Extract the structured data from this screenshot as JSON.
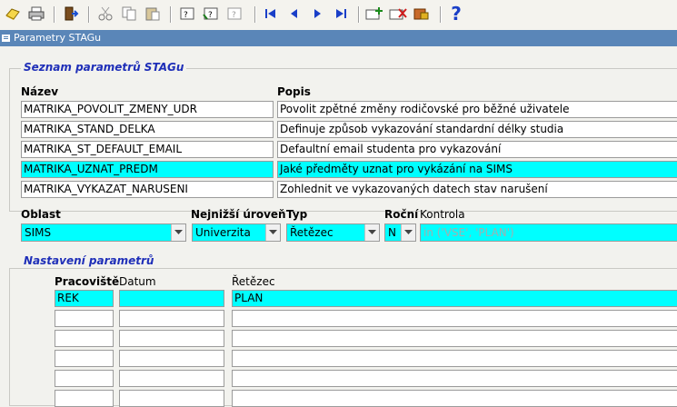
{
  "window": {
    "title": "Parametry STAGu"
  },
  "toolbar": {
    "icons": [
      "save-icon",
      "print-icon",
      "exit-icon",
      "cut-icon",
      "copy-icon",
      "paste-icon",
      "query-icon",
      "execute-query-icon",
      "cancel-query-icon",
      "first-record-icon",
      "previous-record-icon",
      "next-record-icon",
      "last-record-icon",
      "insert-record-icon",
      "delete-record-icon",
      "lock-record-icon",
      "help-icon"
    ],
    "help_label": "?"
  },
  "param_list": {
    "section_title": "Seznam parametrů STAGu",
    "col_name_header": "Název",
    "col_desc_header": "Popis",
    "rows": [
      {
        "name": "MATRIKA_POVOLIT_ZMENY_UDR",
        "desc": "Povolit zpětné změny rodičovské pro běžné uživatele",
        "selected": false
      },
      {
        "name": "MATRIKA_STAND_DELKA",
        "desc": "Definuje způsob vykazování standardní délky studia",
        "selected": false
      },
      {
        "name": "MATRIKA_ST_DEFAULT_EMAIL",
        "desc": "Defaultní email studenta pro vykazování",
        "selected": false
      },
      {
        "name": "MATRIKA_UZNAT_PREDM",
        "desc": "Jaké předměty uznat pro vykázání na SIMS",
        "selected": true
      },
      {
        "name": "MATRIKA_VYKAZAT_NARUSENI",
        "desc": "Zohlednit ve vykazovaných datech stav narušení",
        "selected": false
      }
    ]
  },
  "detail": {
    "oblast_label": "Oblast",
    "oblast_value": "SIMS",
    "uroven_label": "Nejnižší úroveň",
    "uroven_value": "Univerzita",
    "typ_label": "Typ",
    "typ_value": "Řetězec",
    "rocni_label": "Roční",
    "rocni_value": "N",
    "kontrola_label": "Kontrola",
    "kontrola_value": "in ('VSE', 'PLAN')"
  },
  "settings": {
    "section_title": "Nastavení parametrů",
    "col_pracoviste": "Pracoviště",
    "col_datum": "Datum",
    "col_retezec": "Řetězec",
    "rows": [
      {
        "pracoviste": "REK",
        "datum": "",
        "retezec": "PLAN",
        "selected": true
      },
      {
        "pracoviste": "",
        "datum": "",
        "retezec": "",
        "selected": false
      },
      {
        "pracoviste": "",
        "datum": "",
        "retezec": "",
        "selected": false
      },
      {
        "pracoviste": "",
        "datum": "",
        "retezec": "",
        "selected": false
      },
      {
        "pracoviste": "",
        "datum": "",
        "retezec": "",
        "selected": false
      },
      {
        "pracoviste": "",
        "datum": "",
        "retezec": "",
        "selected": false
      }
    ]
  },
  "colors": {
    "selection": "#00ffff",
    "section_title": "#1f2fb8",
    "titlebar": "#5a86b8"
  }
}
